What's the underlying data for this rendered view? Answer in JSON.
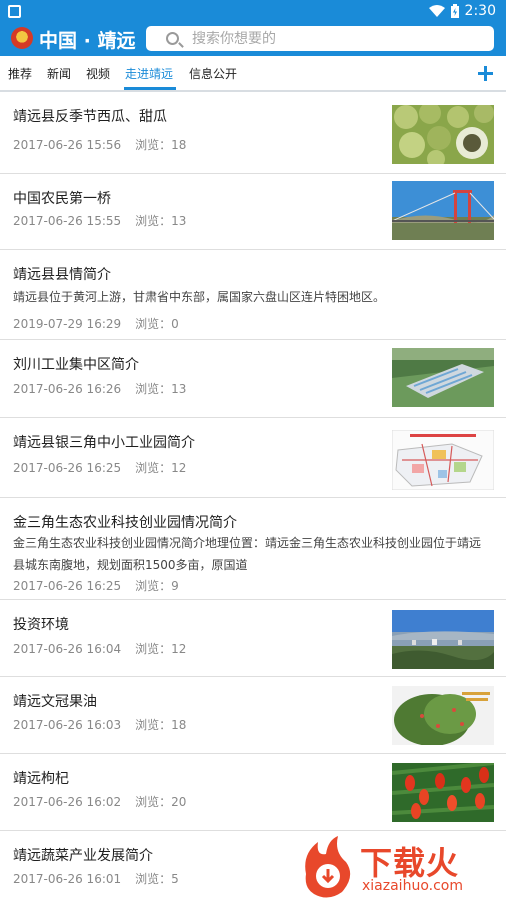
{
  "status": {
    "time": "2:30"
  },
  "app": {
    "title": "中国 · 靖远"
  },
  "search": {
    "placeholder": "搜索你想要的"
  },
  "tabs": [
    {
      "label": "推荐",
      "active": false
    },
    {
      "label": "新闻",
      "active": false
    },
    {
      "label": "视频",
      "active": false
    },
    {
      "label": "走进靖远",
      "active": true
    },
    {
      "label": "信息公开",
      "active": false
    }
  ],
  "articles": [
    {
      "title": "靖远县反季节西瓜、甜瓜",
      "date": "2017-06-26 15:56",
      "views": "浏览：18",
      "thumb": "melons"
    },
    {
      "title": "中国农民第一桥",
      "date": "2017-06-26 15:55",
      "views": "浏览：13",
      "thumb": "bridge"
    },
    {
      "title": "靖远县县情简介",
      "summary": "靖远县位于黄河上游，甘肃省中东部，属国家六盘山区连片特困地区。",
      "date": "2019-07-29 16:29",
      "views": "浏览：0"
    },
    {
      "title": "刘川工业集中区简介",
      "date": "2017-06-26 16:26",
      "views": "浏览：13",
      "thumb": "industrial-park"
    },
    {
      "title": "靖远县银三角中小工业园简介",
      "date": "2017-06-26 16:25",
      "views": "浏览：12",
      "thumb": "park-map"
    },
    {
      "title": "金三角生态农业科技创业园情况简介",
      "summary": "金三角生态农业科技创业园情况简介地理位置：靖远金三角生态农业科技创业园位于靖远县城东南腹地，规划面积1500多亩，原国道",
      "date": "2017-06-26 16:25",
      "views": "浏览：9"
    },
    {
      "title": "投资环境",
      "date": "2017-06-26 16:04",
      "views": "浏览：12",
      "thumb": "city-view"
    },
    {
      "title": "靖远文冠果油",
      "date": "2017-06-26 16:03",
      "views": "浏览：18",
      "thumb": "tree"
    },
    {
      "title": "靖远枸杞",
      "date": "2017-06-26 16:02",
      "views": "浏览：20",
      "thumb": "goji"
    },
    {
      "title": "靖远蔬菜产业发展简介",
      "date": "2017-06-26 16:01",
      "views": "浏览：5"
    }
  ],
  "watermark": {
    "text": "下载火",
    "url": "xiazaihuo.com"
  },
  "colors": {
    "primary": "#1a8bd8",
    "watermark": "#e8482b"
  }
}
